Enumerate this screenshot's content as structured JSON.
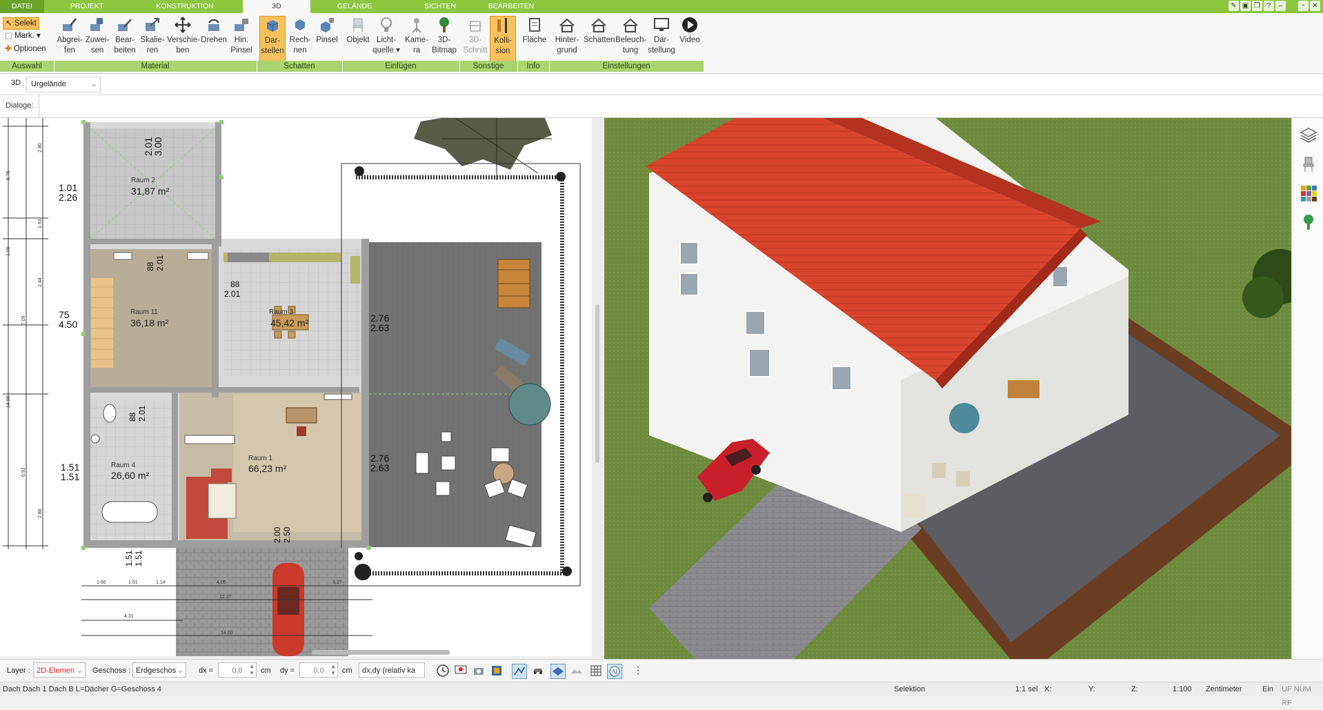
{
  "tabs": [
    {
      "label": "DATEI"
    },
    {
      "label": "PROJEKT"
    },
    {
      "label": "KONSTRUKTION"
    },
    {
      "label": "3D"
    },
    {
      "label": "GELÄNDE"
    },
    {
      "label": "SICHTEN"
    },
    {
      "label": "BEARBEITEN"
    }
  ],
  "ribbon": {
    "auswahl": {
      "selekt": "Selekt",
      "mark": "Mark.",
      "optionen": "Optionen",
      "group": "Auswahl"
    },
    "material": {
      "group": "Material",
      "buttons": [
        {
          "l1": "Abgrei-",
          "l2": "fen",
          "icon": "eyedropper-icon"
        },
        {
          "l1": "Zuwei-",
          "l2": "sen",
          "icon": "assign-icon"
        },
        {
          "l1": "Bear-",
          "l2": "beiten",
          "icon": "edit-icon"
        },
        {
          "l1": "Skalie-",
          "l2": "ren",
          "icon": "scale-icon"
        },
        {
          "l1": "Verschie-",
          "l2": "ben",
          "icon": "move-icon"
        },
        {
          "l1": "Drehen",
          "l2": "",
          "icon": "rotate-icon"
        },
        {
          "l1": "Hin.",
          "l2": "Pinsel",
          "icon": "brush-icon"
        }
      ]
    },
    "schatten": {
      "group": "Schatten",
      "buttons": [
        {
          "l1": "Dar-",
          "l2": "stellen",
          "icon": "cube-shadow-icon"
        },
        {
          "l1": "Rech-",
          "l2": "nen",
          "icon": "cube-icon"
        },
        {
          "l1": "Pinsel",
          "l2": "",
          "icon": "paint-cube-icon"
        }
      ]
    },
    "einfuegen": {
      "group": "Einfügen",
      "buttons": [
        {
          "l1": "Objekt",
          "l2": "",
          "icon": "chair-icon"
        },
        {
          "l1": "Licht-",
          "l2": "quelle",
          "icon": "lightbulb-icon"
        },
        {
          "l1": "Kame-",
          "l2": "ra",
          "icon": "camera-icon"
        },
        {
          "l1": "3D-",
          "l2": "Bitmap",
          "icon": "tree-icon"
        }
      ]
    },
    "sonstige": {
      "group": "Sonstige",
      "buttons": [
        {
          "l1": "3D-",
          "l2": "Schnitt",
          "icon": "section-icon"
        },
        {
          "l1": "Kolli-",
          "l2": "sion",
          "icon": "collision-icon"
        }
      ]
    },
    "info": {
      "group": "Info",
      "buttons": [
        {
          "l1": "Fläche",
          "l2": "",
          "icon": "area-icon"
        }
      ]
    },
    "einstellungen": {
      "group": "Einstellungen",
      "buttons": [
        {
          "l1": "Hinter-",
          "l2": "grund",
          "icon": "background-icon"
        },
        {
          "l1": "Schatten",
          "l2": "",
          "icon": "house-shadow-icon"
        },
        {
          "l1": "Beleuch-",
          "l2": "tung",
          "icon": "house-light-icon"
        },
        {
          "l1": "Dar-",
          "l2": "stellung",
          "icon": "monitor-icon"
        },
        {
          "l1": "Video",
          "l2": "",
          "icon": "play-icon"
        }
      ]
    }
  },
  "toolbar2": {
    "mode": "3D",
    "dropdown": "Urgelände"
  },
  "dialoge": {
    "label": "Dialoge:"
  },
  "plan": {
    "rooms": [
      {
        "name": "Raum 2",
        "area": "31,87 m²"
      },
      {
        "name": "Raum 11",
        "area": "36,18 m²"
      },
      {
        "name": "Raum 3",
        "area": "45,42 m²"
      },
      {
        "name": "Raum 4",
        "area": "26,60 m²"
      },
      {
        "name": "Raum 1",
        "area": "66,23 m²"
      }
    ],
    "dims": {
      "d1a": "1.01",
      "d1b": "2.26",
      "d2a": "75",
      "d2b": "4.50",
      "d3a": "1.51",
      "d3b": "1.51",
      "d4a": "2.01",
      "d4b": "3.00",
      "d5a": "88",
      "d5b": "2.01",
      "d6a": "88",
      "d6b": "2.01",
      "d7a": "2.76",
      "d7b": "2.63",
      "d8a": "2.76",
      "d8b": "2.63",
      "d9a": "88",
      "d9b": "2.01",
      "d10a": "2.00",
      "d10b": "2.50",
      "d11a": "1.51",
      "d11b": "1.51"
    },
    "rulerTexts": [
      "1.66",
      "1.51",
      "1.14",
      "4.05",
      "3.27",
      "12.27",
      "4.31",
      "14.00"
    ],
    "rulerTextsV": [
      "5.75",
      "2.80",
      "1.93",
      "1.00",
      "2.44",
      "7.09",
      "14.00",
      "6.92",
      "2.88"
    ],
    "superscript5": "5"
  },
  "rightstrip": {
    "icons": [
      "layers-icon",
      "chair-panel-icon",
      "material-palette-icon",
      "plant-icon"
    ]
  },
  "bottombar": {
    "layer_label": "Layer :",
    "layer_value": "2D-Elemen",
    "geschoss_label": "Geschoss :",
    "geschoss_value": "Erdgeschos",
    "dx_label": "dx =",
    "dx_value": "0,0",
    "dx_unit": "cm",
    "dy_label": "dy =",
    "dy_value": "0,0",
    "dy_unit": "cm",
    "rel_value": "dx,dy (relativ ka"
  },
  "status": {
    "left": "Dach Dach 1 Dach B L=Dächer G=Geschoss 4",
    "mode": "Selektion",
    "sel": "1:1 sel",
    "x": "X:",
    "y": "Y:",
    "z": "Z:",
    "scale": "1:100",
    "unit": "Zentimeter",
    "ein": "Ein",
    "flags": "UF NUM RF"
  },
  "colors": {
    "accent_green": "#8cc63f",
    "group_green": "#a9d46f",
    "active_orange": "#f8c15a",
    "roof_red": "#d9452c",
    "grass": "#6f8a3a"
  }
}
